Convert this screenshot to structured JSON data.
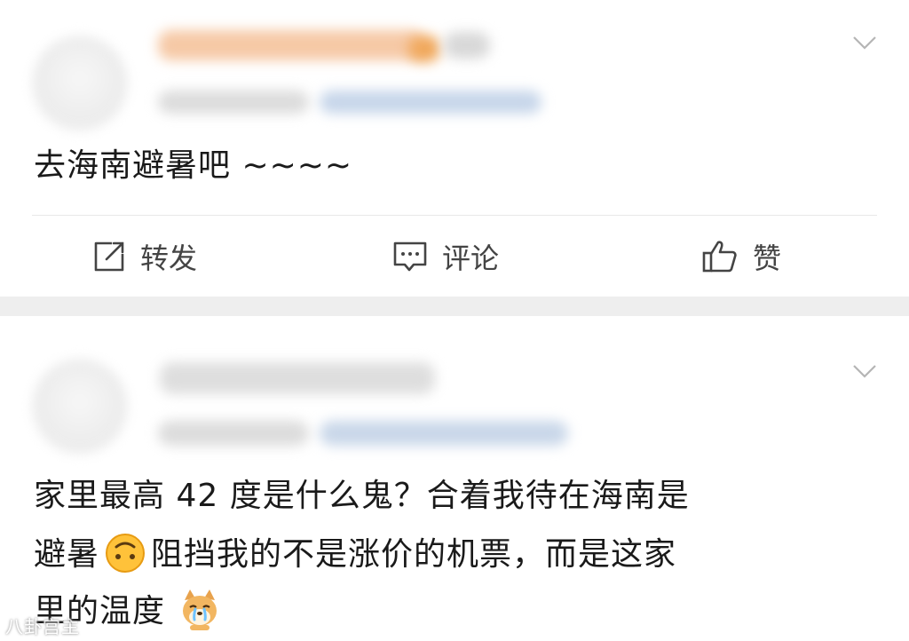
{
  "post1": {
    "content": "去海南避暑吧 ~~~~",
    "actions": {
      "repost_label": "转发",
      "comment_label": "评论",
      "like_label": "赞"
    }
  },
  "post2": {
    "content_line1": "家里最高 42 度是什么鬼？合着我待在海南是",
    "content_line2a": "避暑",
    "content_line2b": "阻挡我的不是涨价的机票，而是这家",
    "content_line3": "里的温度",
    "emoji1": "upside-down-face-emoji",
    "emoji2": "crying-dog-emoji"
  },
  "watermark": "八卦宫主",
  "icons": {
    "chevron": "chevron-down-icon",
    "repost": "repost-icon",
    "comment": "comment-icon",
    "like": "thumbs-up-icon"
  },
  "colors": {
    "accent_blur": "#f3b98c",
    "link_blur": "#9bb7dc",
    "separator": "#eeeeee"
  }
}
